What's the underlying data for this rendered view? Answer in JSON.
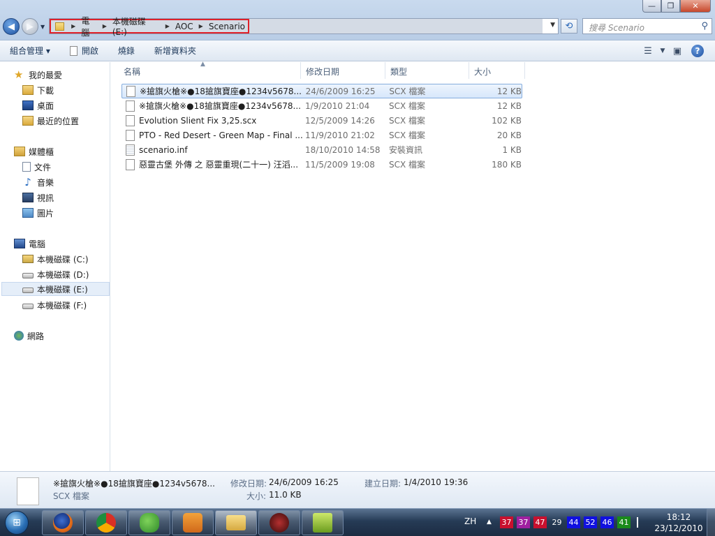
{
  "window": {
    "controls": [
      "—",
      "❐",
      "✕"
    ]
  },
  "nav": {
    "back_icon": "back-arrow-icon",
    "forward_icon": "forward-arrow-icon"
  },
  "address": {
    "crumbs": [
      "電腦",
      "本機磁碟 (E:)",
      "AOC",
      "Scenario"
    ],
    "separator": "▶"
  },
  "search": {
    "placeholder": "搜尋 Scenario"
  },
  "toolbar": {
    "organize": "組合管理 ▾",
    "open": "開啟",
    "burn": "燒錄",
    "new_folder": "新增資料夾"
  },
  "sidebar": {
    "favorites": "我的最愛",
    "downloads": "下載",
    "desktop": "桌面",
    "recent": "最近的位置",
    "libraries": "媒體櫃",
    "documents": "文件",
    "music": "音樂",
    "videos": "視訊",
    "pictures": "圖片",
    "computer": "電腦",
    "drive_c": "本機磁碟 (C:)",
    "drive_d": "本機磁碟 (D:)",
    "drive_e": "本機磁碟 (E:)",
    "drive_f": "本機磁碟 (F:)",
    "network": "網路"
  },
  "columns": {
    "name": "名稱",
    "modified": "修改日期",
    "type": "類型",
    "size": "大小"
  },
  "files": [
    {
      "name": "※搶旗火槍※●18搶旗寶座●1234v5678...",
      "modified": "24/6/2009 16:25",
      "type": "SCX 檔案",
      "size": "12 KB"
    },
    {
      "name": "※搶旗火槍※●18搶旗寶座●1234v5678...",
      "modified": "1/9/2010 21:04",
      "type": "SCX 檔案",
      "size": "12 KB"
    },
    {
      "name": "Evolution Slient Fix 3,25.scx",
      "modified": "12/5/2009 14:26",
      "type": "SCX 檔案",
      "size": "102 KB"
    },
    {
      "name": "PTO - Red Desert - Green  Map - Final ...",
      "modified": "11/9/2010 21:02",
      "type": "SCX 檔案",
      "size": "20 KB"
    },
    {
      "name": "scenario.inf",
      "modified": "18/10/2010 14:58",
      "type": "安裝資訊",
      "size": "1 KB"
    },
    {
      "name": "惡靈古堡 外傳 之 惡靈重現(二十一) 汪滔...",
      "modified": "11/5/2009 19:08",
      "type": "SCX 檔案",
      "size": "180 KB"
    }
  ],
  "details": {
    "filename": "※搶旗火槍※●18搶旗寶座●1234v5678...",
    "filetype": "SCX 檔案",
    "modified_label": "修改日期:",
    "modified_value": "24/6/2009 16:25",
    "size_label": "大小:",
    "size_value": "11.0 KB",
    "created_label": "建立日期:",
    "created_value": "1/4/2010 19:36"
  },
  "taskbar": {
    "ime": "ZH",
    "tray_arrow": "▲",
    "indicators": [
      {
        "value": "37",
        "color": "#c8102e"
      },
      {
        "value": "37",
        "color": "#a020a0"
      },
      {
        "value": "47",
        "color": "#c8102e"
      },
      {
        "value": "29",
        "color": ""
      },
      {
        "value": "44",
        "color": "#1010e0"
      },
      {
        "value": "52",
        "color": "#1010e0"
      },
      {
        "value": "46",
        "color": "#1010e0"
      },
      {
        "value": "41",
        "color": "#1a8a1a"
      }
    ],
    "time": "18:12",
    "date": "23/12/2010"
  }
}
